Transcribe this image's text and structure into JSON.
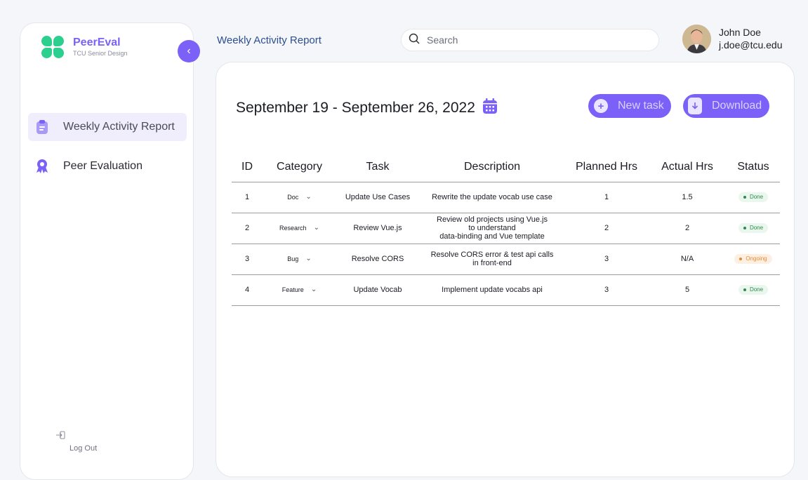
{
  "brand": {
    "name": "PeerEval",
    "subtitle": "TCU Senior Design"
  },
  "sidebar": {
    "items": [
      {
        "label": "Weekly Activity Report",
        "icon": "clipboard-icon",
        "active": true
      },
      {
        "label": "Peer Evaluation",
        "icon": "award-icon",
        "active": false
      }
    ],
    "logout_label": "Log Out"
  },
  "header": {
    "title": "Weekly Activity Report",
    "search_placeholder": "Search"
  },
  "user": {
    "name": "John Doe",
    "email": "j.doe@tcu.edu"
  },
  "report": {
    "date_range": "September 19 - September 26, 2022",
    "new_task_label": "New task",
    "download_label": "Download"
  },
  "table": {
    "columns": [
      "ID",
      "Category",
      "Task",
      "Description",
      "Planned Hrs",
      "Actual Hrs",
      "Status"
    ],
    "rows": [
      {
        "id": "1",
        "category": "Doc",
        "task": "Update Use Cases",
        "description": "Rewrite the update vocab use case",
        "planned": "1",
        "actual": "1.5",
        "status": "Done"
      },
      {
        "id": "2",
        "category": "Research",
        "task": "Review Vue.js",
        "description": "Review old projects using Vue.js\nto understand\ndata-binding and Vue template",
        "planned": "2",
        "actual": "2",
        "status": "Done"
      },
      {
        "id": "3",
        "category": "Bug",
        "task": "Resolve CORS",
        "description": "Resolve CORS error & test api calls\nin front-end",
        "planned": "3",
        "actual": "N/A",
        "status": "Ongoing"
      },
      {
        "id": "4",
        "category": "Feature",
        "task": "Update Vocab",
        "description": "Implement update vocabs api",
        "planned": "3",
        "actual": "5",
        "status": "Done"
      }
    ]
  },
  "colors": {
    "accent": "#7b61f7",
    "brand_green": "#2bcf8e",
    "done": "#2e8a4c",
    "ongoing": "#e6892e"
  }
}
